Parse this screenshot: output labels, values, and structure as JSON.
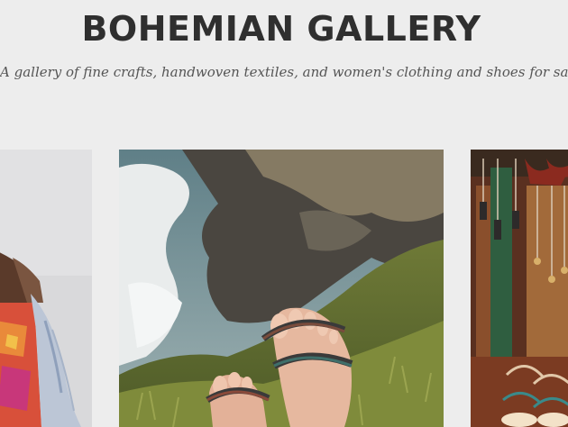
{
  "header": {
    "title": "BOHEMIAN GALLERY",
    "tagline": "A gallery of fine crafts, handwoven textiles, and women's clothing and shoes for sale"
  },
  "gallery": {
    "items": [
      {
        "subject": "woman in embroidered clothing with scarf"
      },
      {
        "subject": "feet in woven strap sandals on grassy coastal cliff"
      },
      {
        "subject": "hanging jewelry and sandals display"
      }
    ]
  }
}
